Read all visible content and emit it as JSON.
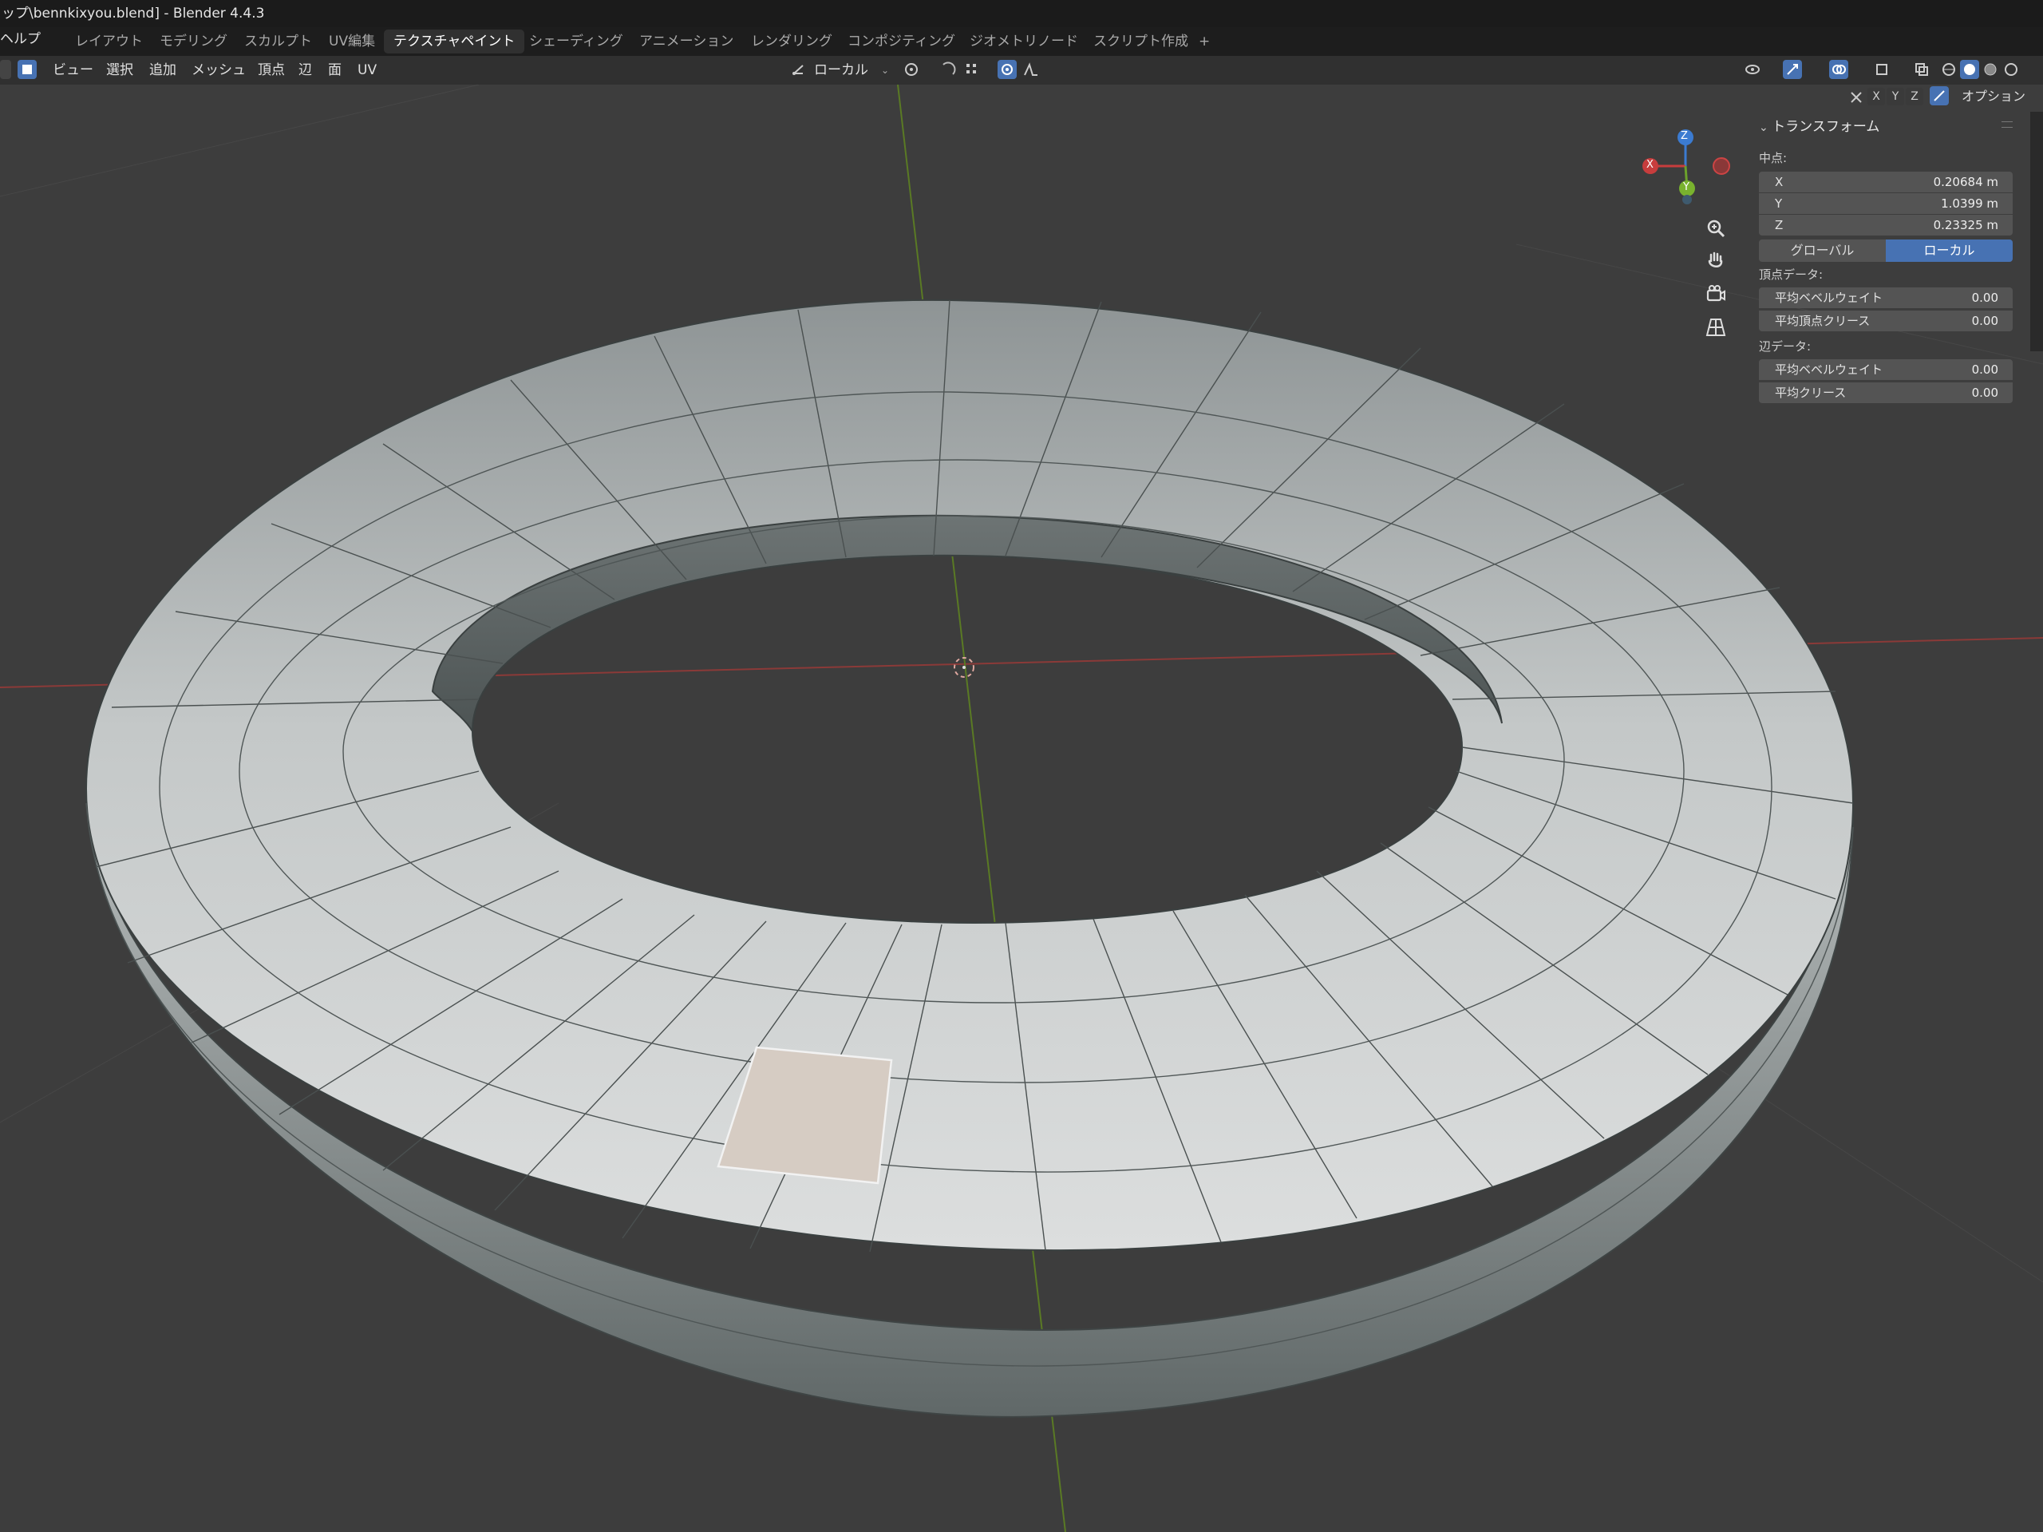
{
  "window": {
    "title": "ップ\\bennkixyou.blend] - Blender 4.4.3"
  },
  "menu": {
    "help": "ヘルプ"
  },
  "workspaces": [
    {
      "label": "レイアウト"
    },
    {
      "label": "モデリング"
    },
    {
      "label": "スカルプト"
    },
    {
      "label": "UV編集"
    },
    {
      "label": "テクスチャペイント"
    },
    {
      "label": "シェーディング"
    },
    {
      "label": "アニメーション"
    },
    {
      "label": "レンダリング"
    },
    {
      "label": "コンポジティング"
    },
    {
      "label": "ジオメトリノード"
    },
    {
      "label": "スクリプト作成"
    }
  ],
  "workspace_add": "+",
  "header": {
    "menus": [
      "ビュー",
      "選択",
      "追加",
      "メッシュ",
      "頂点",
      "辺",
      "面",
      "UV"
    ],
    "orientation": "ローカル"
  },
  "viewport_header": {
    "axes": [
      "X",
      "Y",
      "Z"
    ],
    "options": "オプション"
  },
  "gizmo": {
    "z": "Z",
    "x": "X",
    "y": "Y"
  },
  "transform_panel": {
    "title": "トランスフォーム",
    "median_label": "中点:",
    "x_label": "X",
    "x_value": "0.20684 m",
    "y_label": "Y",
    "y_value": "1.0399 m",
    "z_label": "Z",
    "z_value": "0.23325 m",
    "global_label": "グローバル",
    "local_label": "ローカル",
    "vertex_data_label": "頂点データ:",
    "vertex_bevel_label": "平均ベベルウェイト",
    "vertex_bevel_value": "0.00",
    "vertex_crease_label": "平均頂点クリース",
    "vertex_crease_value": "0.00",
    "edge_data_label": "辺データ:",
    "edge_bevel_label": "平均ベベルウェイト",
    "edge_bevel_value": "0.00",
    "edge_crease_label": "平均クリース",
    "edge_crease_value": "0.00"
  },
  "colors": {
    "accent": "#4772b3",
    "selected_face": "#d9cfc6",
    "axis_x": "#b8403d",
    "axis_y": "#6a8e23"
  }
}
